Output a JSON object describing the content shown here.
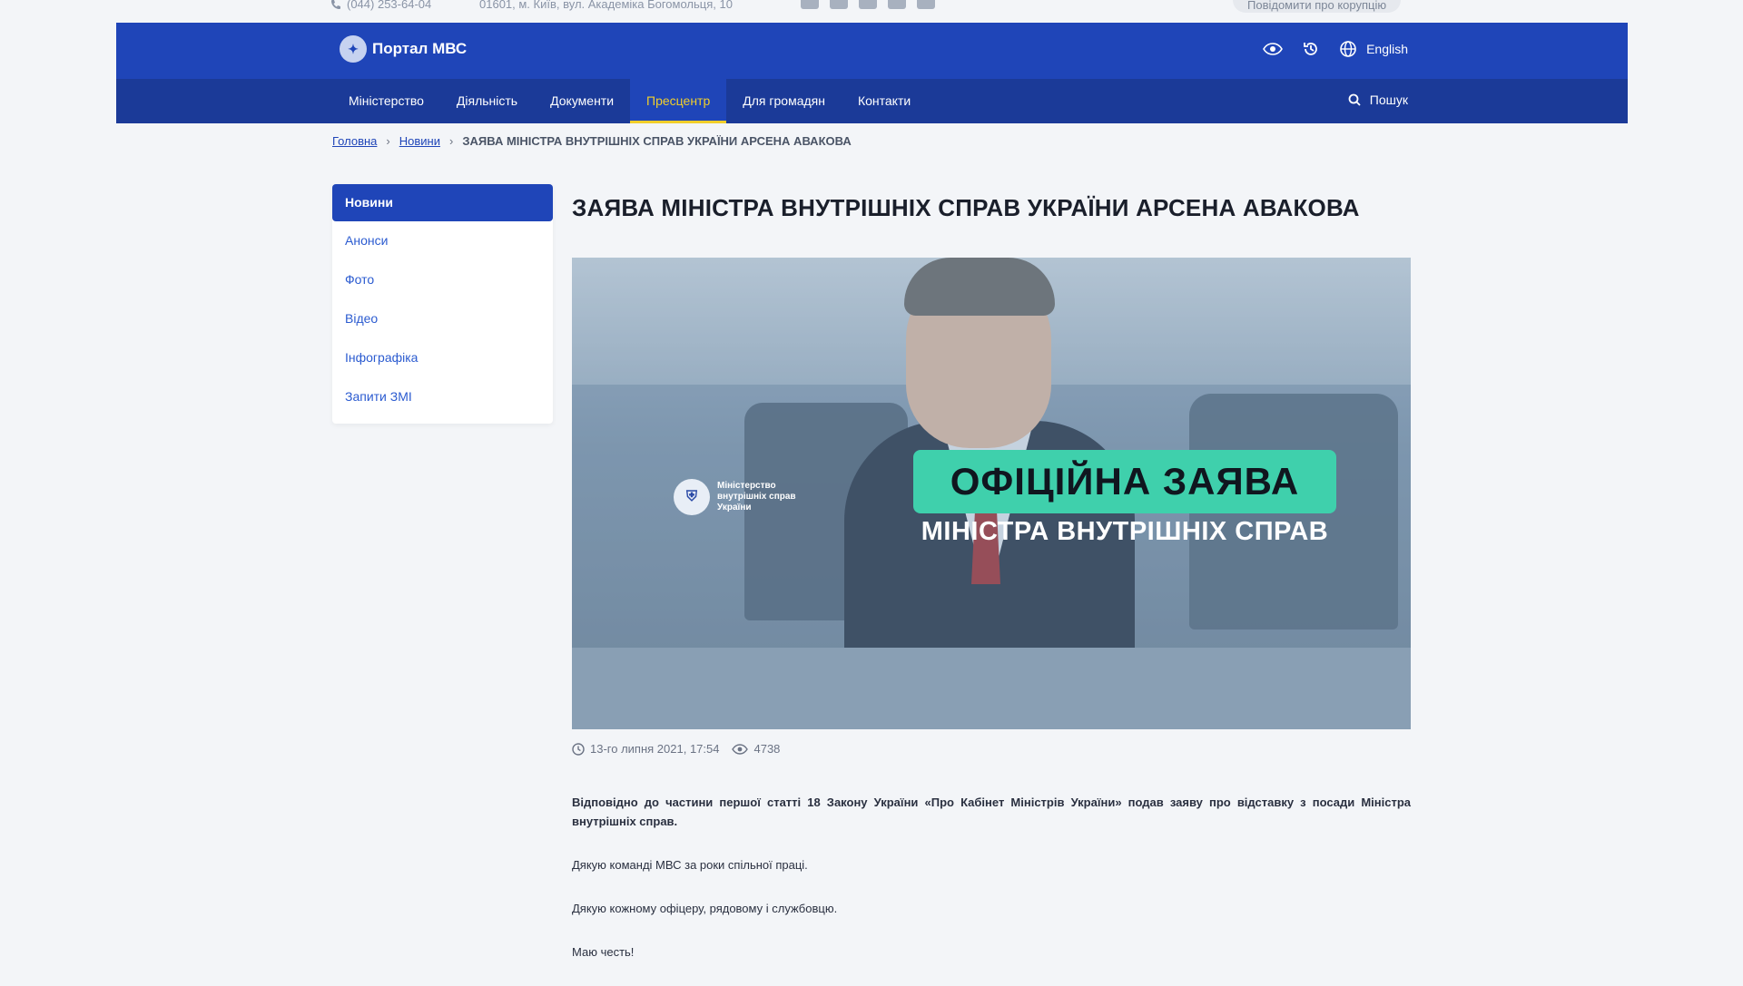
{
  "topbar": {
    "phone": "(044) 253-64-04",
    "address": "01601, м. Київ, вул. Академіка Богомольця, 10",
    "socials": [
      "facebook-icon",
      "twitter-icon",
      "youtube-icon",
      "instagram-icon",
      "telegram-icon"
    ],
    "report_label": "Повідомити про корупцію"
  },
  "header": {
    "logo_text": "Портал МВС",
    "language": "English",
    "search_label": "Пошук"
  },
  "nav": {
    "items": [
      {
        "label": "Міністерство"
      },
      {
        "label": "Діяльність"
      },
      {
        "label": "Документи"
      },
      {
        "label": "Пресцентр",
        "active": true
      },
      {
        "label": "Для громадян"
      },
      {
        "label": "Контакти"
      }
    ]
  },
  "breadcrumb": {
    "home": "Головна",
    "news": "Новини",
    "current": "ЗАЯВА МІНІСТРА ВНУТРІШНІХ СПРАВ УКРАЇНИ АРСЕНА АВАКОВА"
  },
  "sidebar": {
    "items": [
      {
        "label": "Новини",
        "active": true
      },
      {
        "label": "Анонси"
      },
      {
        "label": "Фото"
      },
      {
        "label": "Відео"
      },
      {
        "label": "Інфографіка"
      },
      {
        "label": "Запити ЗМІ"
      }
    ]
  },
  "article": {
    "title": "ЗАЯВА МІНІСТРА ВНУТРІШНІХ СПРАВ УКРАЇНИ АРСЕНА АВАКОВА",
    "image": {
      "ministry_line1": "Міністерство",
      "ministry_line2": "внутрішніх справ",
      "ministry_line3": "України",
      "badge": "ОФІЦІЙНА ЗАЯВА",
      "subtitle": "МІНІСТРА ВНУТРІШНІХ СПРАВ"
    },
    "date": "13-го липня 2021, 17:54",
    "views": "4738",
    "paragraphs": [
      "Відповідно до частини першої статті 18 Закону України «Про Кабінет Міністрів України» подав заяву про відставку з посади Міністра внутрішніх справ.",
      "Дякую команді МВС за роки спільної праці.",
      "Дякую кожному офіцеру, рядовому і службовцю.",
      "Маю честь!"
    ]
  },
  "colors": {
    "header": "#1f45b8",
    "nav": "#1b3a98",
    "active_nav": "#f1cf2b",
    "badge": "#3fd0ac"
  }
}
